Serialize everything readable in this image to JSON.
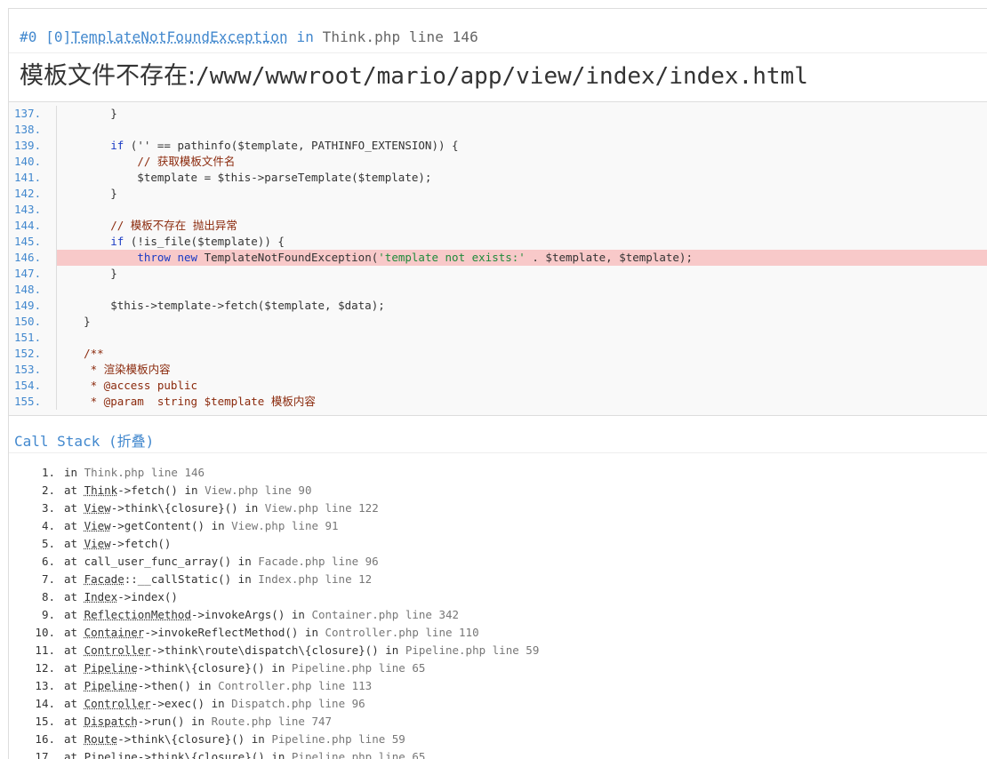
{
  "exception": {
    "index": "#0 [0]",
    "class": "TemplateNotFoundException",
    "in_word": "in",
    "file": "Think.php line 146",
    "message_cn": "模板文件不存在:",
    "message_path": "/www/wwwroot/mario/app/view/index/index.html"
  },
  "source": {
    "highlight": 146,
    "lines": [
      {
        "n": "137.",
        "html": "        <span>}</span>"
      },
      {
        "n": "138.",
        "html": ""
      },
      {
        "n": "139.",
        "html": "        <span class=\"kw\">if</span> ('' == pathinfo($template, PATHINFO_EXTENSION)) {"
      },
      {
        "n": "140.",
        "html": "            <span class=\"cmt\">// 获取模板文件名</span>"
      },
      {
        "n": "141.",
        "html": "            $template = $this-&gt;parseTemplate($template);"
      },
      {
        "n": "142.",
        "html": "        }"
      },
      {
        "n": "143.",
        "html": ""
      },
      {
        "n": "144.",
        "html": "        <span class=\"cmt\">// 模板不存在 抛出异常</span>"
      },
      {
        "n": "145.",
        "html": "        <span class=\"kw\">if</span> (!is_file($template)) {"
      },
      {
        "n": "146.",
        "html": "            <span class=\"kw\">throw</span> <span class=\"kw\">new</span> TemplateNotFoundException(<span class=\"str\">'template not exists:'</span> . $template, $template);"
      },
      {
        "n": "147.",
        "html": "        }"
      },
      {
        "n": "148.",
        "html": ""
      },
      {
        "n": "149.",
        "html": "        $this-&gt;template-&gt;fetch($template, $data);"
      },
      {
        "n": "150.",
        "html": "    }"
      },
      {
        "n": "151.",
        "html": ""
      },
      {
        "n": "152.",
        "html": "    <span class=\"cmt\">/**</span>"
      },
      {
        "n": "153.",
        "html": "<span class=\"cmt\">     * 渲染模板内容</span>"
      },
      {
        "n": "154.",
        "html": "<span class=\"cmt\">     * @access public</span>"
      },
      {
        "n": "155.",
        "html": "<span class=\"cmt\">     * @param  string $template 模板内容</span>"
      }
    ]
  },
  "call_stack": {
    "title": "Call Stack (折叠)",
    "items": [
      {
        "idx": "1.",
        "pre": "in ",
        "cls": "",
        "rest": "",
        "loc": "Think.php line 146"
      },
      {
        "idx": "2.",
        "pre": "at ",
        "cls": "Think",
        "rest": "->fetch() in ",
        "loc": "View.php line 90"
      },
      {
        "idx": "3.",
        "pre": "at ",
        "cls": "View",
        "rest": "->think\\{closure}() in ",
        "loc": "View.php line 122"
      },
      {
        "idx": "4.",
        "pre": "at ",
        "cls": "View",
        "rest": "->getContent() in ",
        "loc": "View.php line 91"
      },
      {
        "idx": "5.",
        "pre": "at ",
        "cls": "View",
        "rest": "->fetch()",
        "loc": ""
      },
      {
        "idx": "6.",
        "pre": "at ",
        "cls": "",
        "rest": "call_user_func_array() in ",
        "loc": "Facade.php line 96"
      },
      {
        "idx": "7.",
        "pre": "at ",
        "cls": "Facade",
        "rest": "::__callStatic() in ",
        "loc": "Index.php line 12"
      },
      {
        "idx": "8.",
        "pre": "at ",
        "cls": "Index",
        "rest": "->index()",
        "loc": ""
      },
      {
        "idx": "9.",
        "pre": "at ",
        "cls": "ReflectionMethod",
        "rest": "->invokeArgs() in ",
        "loc": "Container.php line 342"
      },
      {
        "idx": "10.",
        "pre": "at ",
        "cls": "Container",
        "rest": "->invokeReflectMethod() in ",
        "loc": "Controller.php line 110"
      },
      {
        "idx": "11.",
        "pre": "at ",
        "cls": "Controller",
        "rest": "->think\\route\\dispatch\\{closure}() in ",
        "loc": "Pipeline.php line 59"
      },
      {
        "idx": "12.",
        "pre": "at ",
        "cls": "Pipeline",
        "rest": "->think\\{closure}() in ",
        "loc": "Pipeline.php line 65"
      },
      {
        "idx": "13.",
        "pre": "at ",
        "cls": "Pipeline",
        "rest": "->then() in ",
        "loc": "Controller.php line 113"
      },
      {
        "idx": "14.",
        "pre": "at ",
        "cls": "Controller",
        "rest": "->exec() in ",
        "loc": "Dispatch.php line 96"
      },
      {
        "idx": "15.",
        "pre": "at ",
        "cls": "Dispatch",
        "rest": "->run() in ",
        "loc": "Route.php line 747"
      },
      {
        "idx": "16.",
        "pre": "at ",
        "cls": "Route",
        "rest": "->think\\{closure}() in ",
        "loc": "Pipeline.php line 59"
      },
      {
        "idx": "17.",
        "pre": "at ",
        "cls": "Pipeline",
        "rest": "->think\\{closure}() in ",
        "loc": "Pipeline.php line 65"
      }
    ]
  }
}
